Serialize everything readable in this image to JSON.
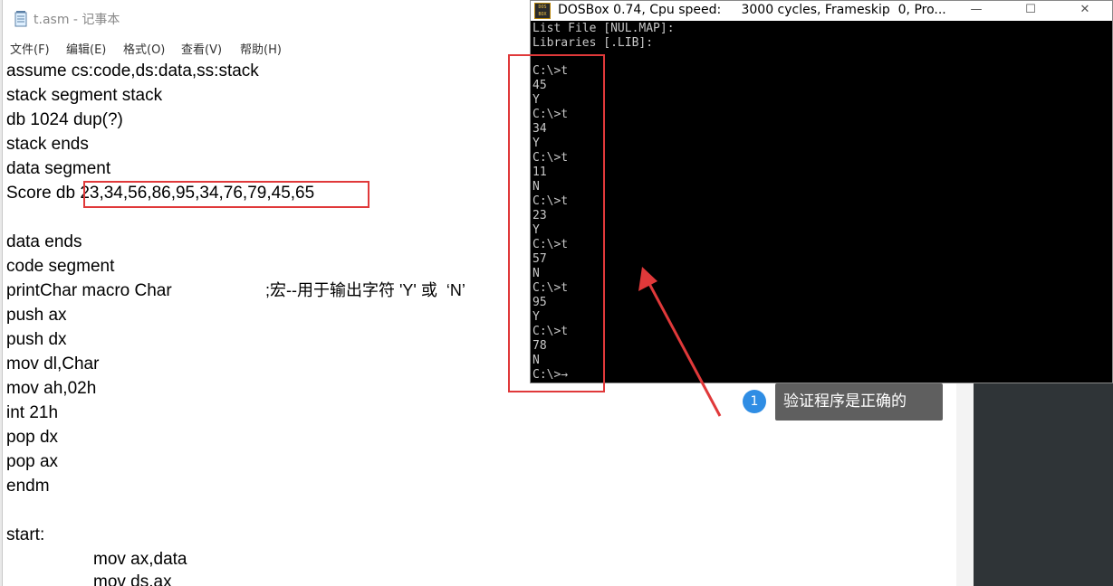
{
  "notepad": {
    "title": "t.asm - 记事本",
    "menu": [
      "文件(F)",
      "编辑(E)",
      "格式(O)",
      "查看(V)",
      "帮助(H)"
    ],
    "lines": [
      "assume cs:code,ds:data,ss:stack",
      "stack segment stack",
      "db 1024 dup(?)",
      "stack ends",
      "data segment",
      "Score db 23,34,56,86,95,34,76,79,45,65",
      "",
      "data ends",
      "code segment",
      "printChar macro Char",
      "push ax",
      "push dx",
      "mov dl,Char",
      "mov ah,02h",
      "int 21h",
      "pop dx",
      "pop ax",
      "endm",
      "",
      "start:",
      "mov ax,data",
      "mov ds,ax"
    ],
    "macro_comment": ";宏--用于输出字符 'Y' 或  ‘N’"
  },
  "dosbox": {
    "title": "DOSBox 0.74, Cpu speed:     3000 cycles, Frameskip  0, Pro...",
    "logo_text": "DOS BOX",
    "window_buttons": [
      "—",
      "☐",
      "✕"
    ],
    "screen_lines": [
      "List File [NUL.MAP]:",
      "Libraries [.LIB]:",
      "",
      "C:\\>t",
      "45",
      "Y",
      "C:\\>t",
      "34",
      "Y",
      "C:\\>t",
      "11",
      "N",
      "C:\\>t",
      "23",
      "Y",
      "C:\\>t",
      "57",
      "N",
      "C:\\>t",
      "95",
      "Y",
      "C:\\>t",
      "78",
      "N",
      "C:\\>→"
    ]
  },
  "annotation": {
    "step_number": "1",
    "text": "验证程序是正确的",
    "color": "#e0393a",
    "badge_color": "#2f8de4"
  }
}
